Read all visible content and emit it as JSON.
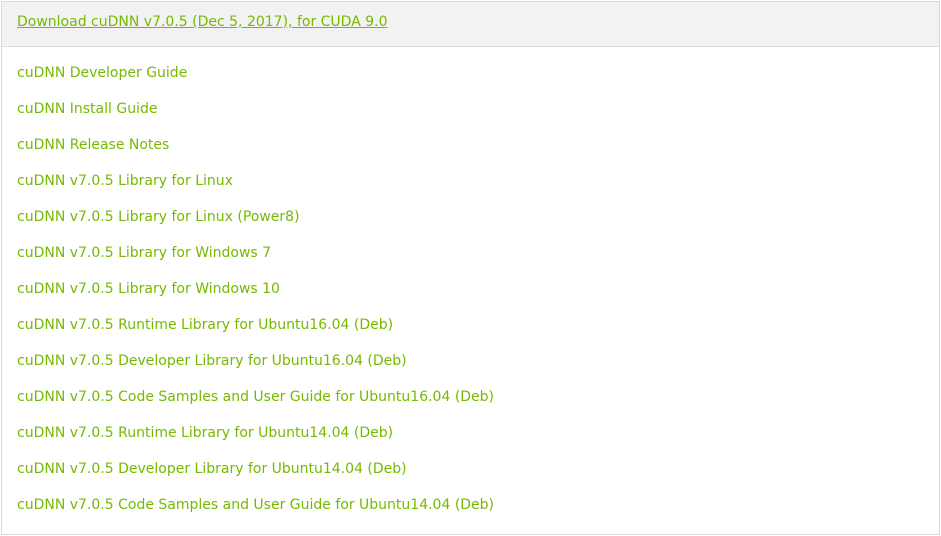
{
  "header": {
    "title": "Download cuDNN v7.0.5 (Dec 5, 2017), for CUDA 9.0"
  },
  "links": [
    "cuDNN Developer Guide",
    "cuDNN Install Guide",
    "cuDNN Release Notes",
    "cuDNN v7.0.5 Library for Linux",
    "cuDNN v7.0.5 Library for Linux (Power8)",
    "cuDNN v7.0.5 Library for Windows 7",
    "cuDNN v7.0.5 Library for Windows 10",
    "cuDNN v7.0.5 Runtime Library for Ubuntu16.04 (Deb)",
    "cuDNN v7.0.5 Developer Library for Ubuntu16.04 (Deb)",
    "cuDNN v7.0.5 Code Samples and User Guide for Ubuntu16.04 (Deb)",
    "cuDNN v7.0.5 Runtime Library for Ubuntu14.04 (Deb)",
    "cuDNN v7.0.5 Developer Library for Ubuntu14.04 (Deb)",
    "cuDNN v7.0.5 Code Samples and User Guide for Ubuntu14.04 (Deb)"
  ],
  "colors": {
    "link": "#76b900",
    "header_bg": "#f2f2f2",
    "border": "#d9d9d9"
  }
}
